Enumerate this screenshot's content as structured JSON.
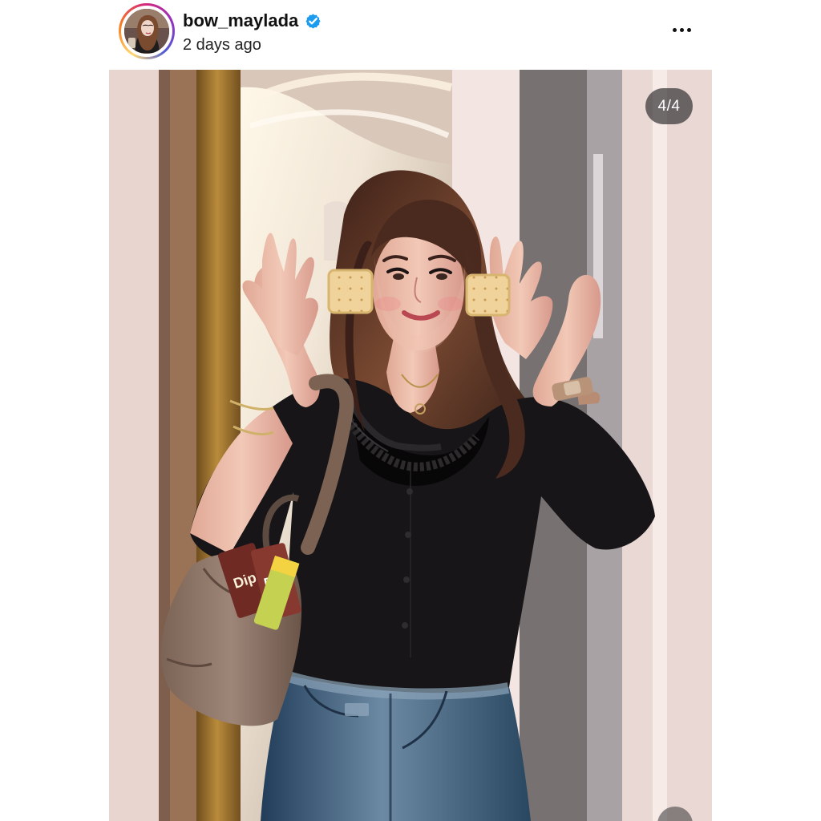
{
  "post": {
    "username": "bow_maylada",
    "timestamp": "2 days ago",
    "counter": "4/4"
  },
  "icons": {
    "verified": "verified-badge-icon",
    "more": "more-options-icon"
  },
  "colors": {
    "verified_blue": "#1d9bf0",
    "text_primary": "#111111",
    "text_secondary": "#222222",
    "counter_background": "#3a3a3a"
  }
}
